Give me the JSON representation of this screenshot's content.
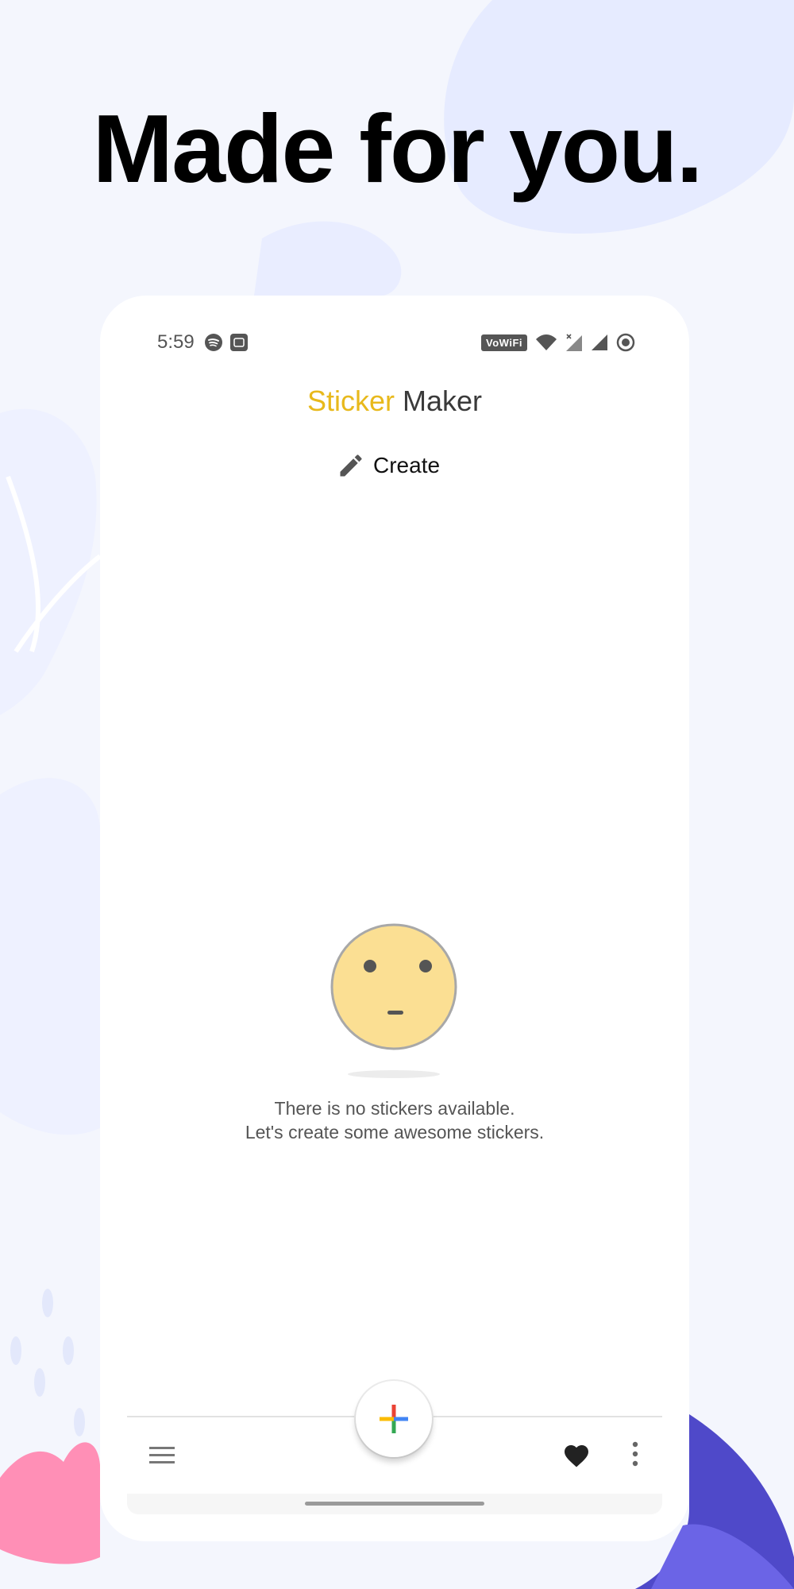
{
  "headline": "Made for you.",
  "status_bar": {
    "time": "5:59",
    "wifi_tag": "VoWiFi"
  },
  "app": {
    "title_part1": "Sticker",
    "title_part2": "Maker",
    "create_label": "Create"
  },
  "empty_state": {
    "line1": "There is no stickers available.",
    "line2": "Let's create some awesome stickers."
  },
  "colors": {
    "title_accent": "#e8b91c",
    "face_fill": "#fbdf93",
    "background": "#f4f6fd"
  },
  "icons": {
    "status_left": [
      "spotify-icon",
      "app-notification-icon"
    ],
    "status_right": [
      "wifi-icon",
      "signal-x-icon",
      "signal-icon",
      "record-icon"
    ],
    "create": "pencil-icon",
    "bottom_left": "menu-icon",
    "bottom_right": [
      "heart-icon",
      "more-vert-icon"
    ],
    "fab": "plus-icon"
  }
}
